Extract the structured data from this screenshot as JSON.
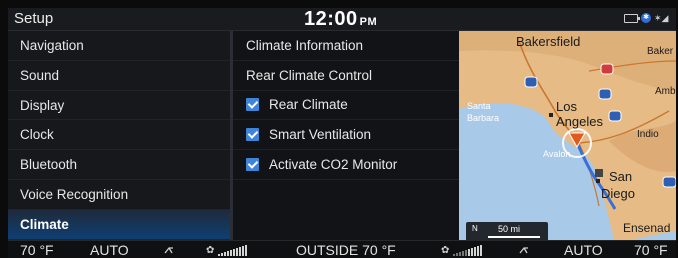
{
  "header": {
    "title": "Setup",
    "time": "12:00",
    "ampm": "PM"
  },
  "left_menu": {
    "items": [
      {
        "label": "Navigation"
      },
      {
        "label": "Sound"
      },
      {
        "label": "Display"
      },
      {
        "label": "Clock"
      },
      {
        "label": "Bluetooth"
      },
      {
        "label": "Voice Recognition"
      },
      {
        "label": "Climate",
        "active": true
      }
    ]
  },
  "mid_panel": {
    "items": [
      {
        "label": "Climate Information"
      },
      {
        "label": "Rear Climate Control"
      },
      {
        "label": "Rear Climate",
        "checked": true
      },
      {
        "label": "Smart Ventilation",
        "checked": true
      },
      {
        "label": "Activate CO2 Monitor",
        "checked": true
      }
    ]
  },
  "map": {
    "labels": {
      "bakersfield": "Bakersfield",
      "baker": "Baker",
      "amb": "Amb",
      "santa": "Santa",
      "barbara": "Barbara",
      "los": "Los",
      "angeles": "Angeles",
      "indio": "Indio",
      "avalon": "Avalon",
      "san": "San",
      "diego": "Diego",
      "ensenada": "Ensenad"
    },
    "shields": [
      "5",
      "40",
      "5",
      "15",
      "8"
    ],
    "scale": {
      "north": "N",
      "text": "50 mi"
    }
  },
  "bottom_bar": {
    "left_temp": "70 °F",
    "left_mode": "AUTO",
    "outside": "OUTSIDE  70 °F",
    "right_mode": "AUTO",
    "right_temp": "70 °F",
    "fan_level_left": 0.55,
    "fan_level_right": 0.55
  },
  "colors": {
    "accent": "#3f84d8",
    "active_bg": "#0f3f72",
    "water": "#a9c9e8",
    "land": "#e8c08e",
    "route": "#3b6fd8"
  }
}
